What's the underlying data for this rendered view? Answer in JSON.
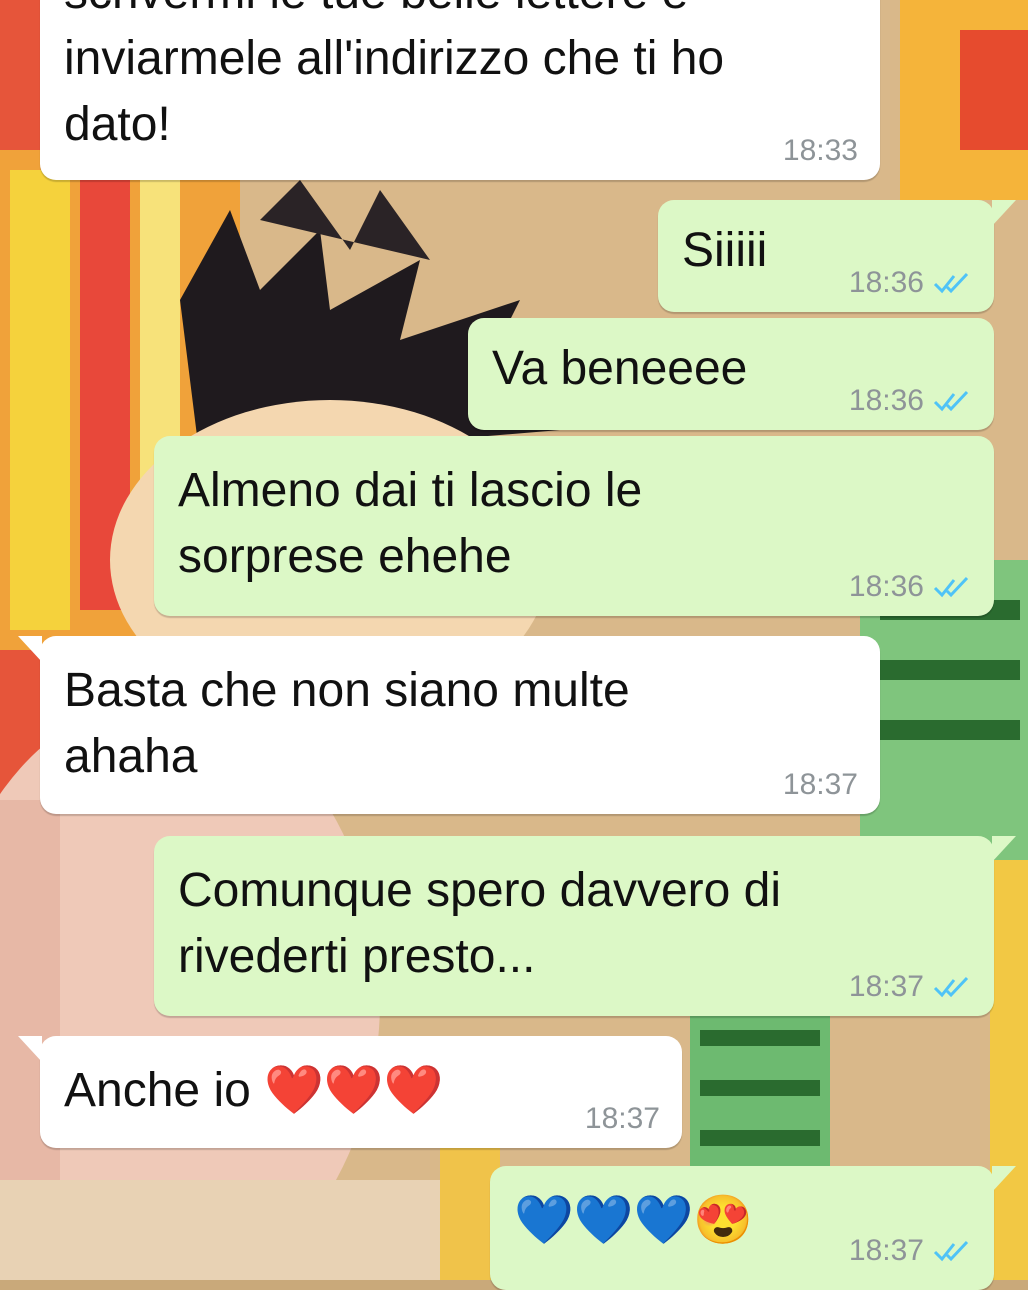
{
  "chat": {
    "messages": [
      {
        "direction": "in",
        "lines": [
          "scrivermi le tue belle lettere e",
          "inviarmele all'indirizzo che ti ho",
          "dato!"
        ],
        "time": "18:33"
      },
      {
        "direction": "out",
        "text": "Siiiii",
        "time": "18:36",
        "status": "read"
      },
      {
        "direction": "out",
        "text": "Va beneeee",
        "time": "18:36",
        "status": "read"
      },
      {
        "direction": "out",
        "lines": [
          "Almeno dai ti lascio le",
          "sorprese ehehe"
        ],
        "time": "18:36",
        "status": "read"
      },
      {
        "direction": "in",
        "lines": [
          "Basta che non siano multe",
          "ahaha"
        ],
        "time": "18:37"
      },
      {
        "direction": "out",
        "lines": [
          "Comunque spero davvero di",
          "rivederti presto..."
        ],
        "time": "18:37",
        "status": "read"
      },
      {
        "direction": "in",
        "text": "Anche io ❤️❤️❤️",
        "time": "18:37"
      },
      {
        "direction": "out",
        "text": "💙💙💙😍",
        "time": "18:37",
        "status": "read"
      }
    ]
  },
  "colors": {
    "incoming_bubble": "#ffffff",
    "outgoing_bubble": "#dcf8c6",
    "read_ticks": "#4fc3f7",
    "timestamp": "#8e9498"
  },
  "icons": {
    "read_receipt": "double-check-icon"
  }
}
